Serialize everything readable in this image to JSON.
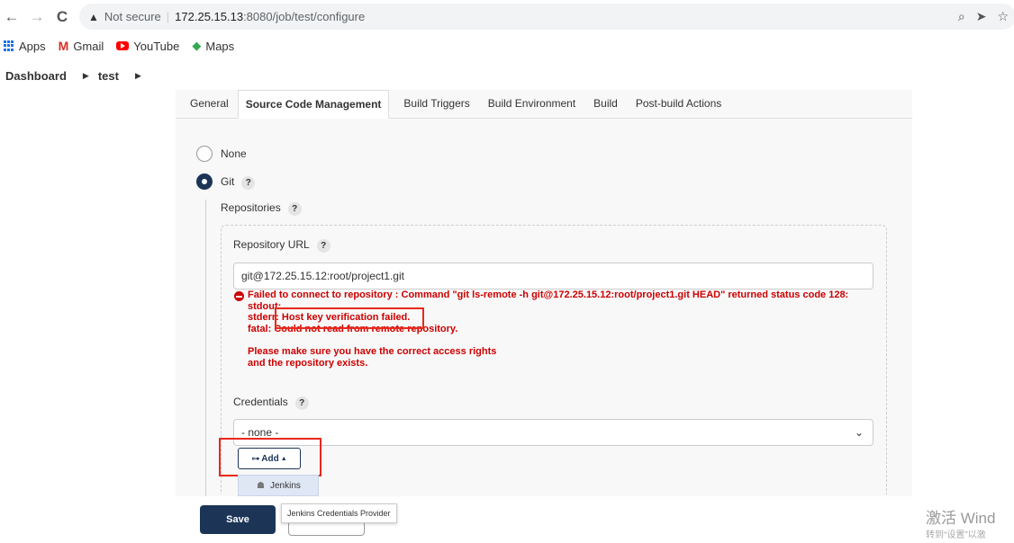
{
  "browser": {
    "not_secure": "Not secure",
    "url_host": "172.25.15.13",
    "url_path": ":8080/job/test/configure"
  },
  "bookmarks": [
    {
      "label": "Apps",
      "icon": "apps-grid-icon"
    },
    {
      "label": "Gmail",
      "icon": "gmail-icon"
    },
    {
      "label": "YouTube",
      "icon": "youtube-icon"
    },
    {
      "label": "Maps",
      "icon": "maps-icon"
    }
  ],
  "breadcrumb": {
    "root": "Dashboard",
    "job": "test"
  },
  "tabs": [
    {
      "label": "General"
    },
    {
      "label": "Source Code Management"
    },
    {
      "label": "Build Triggers"
    },
    {
      "label": "Build Environment"
    },
    {
      "label": "Build"
    },
    {
      "label": "Post-build Actions"
    }
  ],
  "scm": {
    "none_label": "None",
    "git_label": "Git",
    "repositories_label": "Repositories",
    "repo_url_label": "Repository URL",
    "repo_url_value": "git@172.25.15.12:root/project1.git",
    "error": {
      "line1": "Failed to connect to repository : Command \"git ls-remote -h git@172.25.15.12:root/project1.git HEAD\" returned status code 128:",
      "line2": "stdout:",
      "line3": "stderr: Host key verification failed.",
      "line4": "fatal: Could not read from remote repository.",
      "line5": "Please make sure you have the correct access rights",
      "line6": "and the repository exists."
    },
    "credentials_label": "Credentials",
    "credentials_value": "- none -",
    "add_label": "Add",
    "add_menu_item": "Jenkins",
    "tooltip": "Jenkins Credentials Provider"
  },
  "help_mark": "?",
  "buttons": {
    "save": "Save"
  },
  "watermark": {
    "line1": "激活 Wind",
    "line2": "转到“设置”以激"
  },
  "colors": {
    "primary": "#1c3557",
    "error": "#cc0000",
    "highlight": "#e8291c"
  }
}
